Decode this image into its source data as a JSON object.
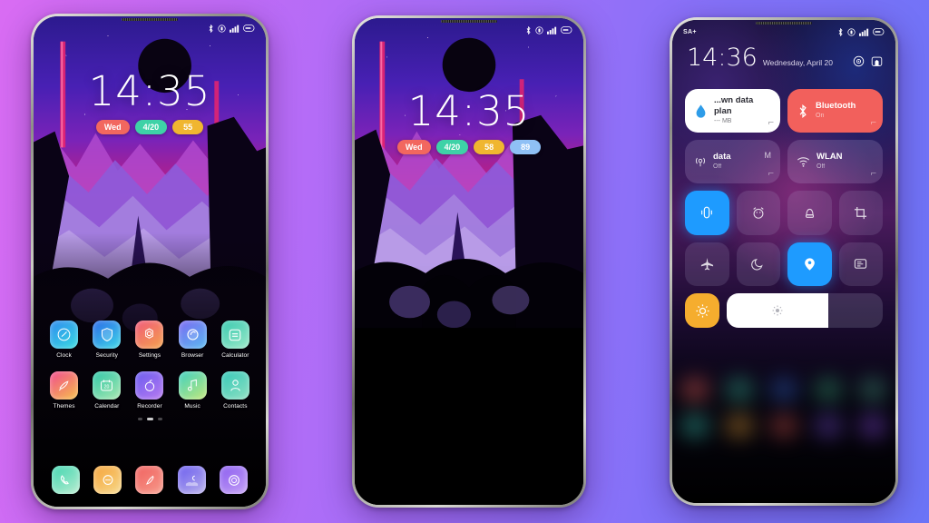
{
  "background": {
    "from": "#d96cf3",
    "to": "#6b74f7"
  },
  "phone1": {
    "name": "home-screen",
    "statusbar": {
      "left": "",
      "icons": [
        "bluetooth-icon",
        "vibrate-icon",
        "signal-icon",
        "battery-icon"
      ]
    },
    "clock": {
      "time": "14:35"
    },
    "badges": [
      {
        "label": "Wed",
        "color": "#f2675f"
      },
      {
        "label": "4/20",
        "color": "#3ed2a7"
      },
      {
        "label": "55",
        "color": "#f0b630"
      }
    ],
    "apps_row1": [
      {
        "label": "Clock",
        "icon": "clock-icon",
        "from": "#2e8bf0",
        "to": "#39dbe0"
      },
      {
        "label": "Security",
        "icon": "shield-icon",
        "from": "#2a6ae8",
        "to": "#3fd8e8"
      },
      {
        "label": "Settings",
        "icon": "gear-icon",
        "from": "#f0597a",
        "to": "#f4a34c"
      },
      {
        "label": "Browser",
        "icon": "globe-icon",
        "from": "#7b6af2",
        "to": "#59b9f0"
      },
      {
        "label": "Calculator",
        "icon": "calculator-icon",
        "from": "#39c9b0",
        "to": "#9ae8c8"
      }
    ],
    "apps_row2": [
      {
        "label": "Themes",
        "icon": "themes-icon",
        "from": "#f04a8e",
        "to": "#f7c04a"
      },
      {
        "label": "Calendar",
        "icon": "calendar-icon",
        "from": "#2fc7a8",
        "to": "#a8e8b0"
      },
      {
        "label": "Recorder",
        "icon": "recorder-icon",
        "from": "#6a5cf0",
        "to": "#b77af0"
      },
      {
        "label": "Music",
        "icon": "music-icon",
        "from": "#3fd0c0",
        "to": "#c2e87a"
      },
      {
        "label": "Contacts",
        "icon": "contacts-icon",
        "from": "#35c8b8",
        "to": "#8fe0c2"
      }
    ],
    "page_dots": {
      "count": 3,
      "active": 1
    },
    "dock": [
      {
        "name": "phone-app-icon",
        "icon": "phone-icon",
        "from": "#3fd6b0",
        "to": "#b8ecd0"
      },
      {
        "name": "messages-app-icon",
        "icon": "message-icon",
        "from": "#f5a33a",
        "to": "#f7d98a"
      },
      {
        "name": "notes-app-icon",
        "icon": "pen-icon",
        "from": "#f0605f",
        "to": "#f79a8a"
      },
      {
        "name": "gallery-app-icon",
        "icon": "moon-icon",
        "from": "#6a5cf0",
        "to": "#b8b0ea"
      },
      {
        "name": "camera-app-icon",
        "icon": "camera-icon",
        "from": "#8a5cf0",
        "to": "#c4a0f5"
      }
    ]
  },
  "phone2": {
    "name": "lock-screen",
    "statusbar": {
      "icons": [
        "bluetooth-icon",
        "vibrate-icon",
        "signal-icon",
        "battery-icon"
      ]
    },
    "clock": {
      "time": "14:35"
    },
    "badges": [
      {
        "label": "Wed",
        "color": "#f2675f"
      },
      {
        "label": "4/20",
        "color": "#3ed2a7"
      },
      {
        "label": "58",
        "color": "#f0b630"
      },
      {
        "label": "89",
        "color": "#8fc0f5"
      }
    ]
  },
  "phone3": {
    "name": "control-center",
    "statusbar": {
      "left": "SA+",
      "icons": [
        "bluetooth-icon",
        "vibrate-icon",
        "signal-icon",
        "battery-icon"
      ]
    },
    "time": "14:36",
    "date": "Wednesday, April 20",
    "head_icons": [
      "settings-target-icon",
      "edit-bookmark-icon"
    ],
    "big_tiles": [
      {
        "name": "mobile-data-plan-tile",
        "title": "...wn data plan",
        "sub": "--- MB",
        "icon": "water-drop-icon",
        "bg": "#ffffff",
        "fg": "#2b2b33",
        "icon_color": "#2e9ce8",
        "active": false
      },
      {
        "name": "bluetooth-tile",
        "title": "Bluetooth",
        "sub": "On",
        "icon": "bluetooth-icon",
        "bg": "#f2605c",
        "fg": "#ffffff",
        "icon_color": "#ffffff",
        "active": true
      }
    ],
    "data_tiles": [
      {
        "name": "mobile-data-tile",
        "title": "data",
        "sub": "Off",
        "right": "M",
        "icon": "cell-signal-icon"
      },
      {
        "name": "wlan-tile",
        "title": "WLAN",
        "sub": "Off",
        "right": "",
        "icon": "wifi-icon"
      }
    ],
    "toggles_row1": [
      {
        "name": "vibrate-toggle",
        "icon": "vibrate-icon",
        "active": true
      },
      {
        "name": "alarm-toggle",
        "icon": "alarm-icon",
        "active": false
      },
      {
        "name": "flashlight-toggle",
        "icon": "flashlight-icon",
        "active": false
      },
      {
        "name": "screenshot-toggle",
        "icon": "crop-icon",
        "active": false
      }
    ],
    "toggles_row2": [
      {
        "name": "airplane-mode-toggle",
        "icon": "airplane-icon",
        "active": false
      },
      {
        "name": "dnd-toggle",
        "icon": "moon-icon",
        "active": false
      },
      {
        "name": "location-toggle",
        "icon": "location-pin-icon",
        "active": true
      },
      {
        "name": "reading-mode-toggle",
        "icon": "reading-icon",
        "active": false
      }
    ],
    "brightness": {
      "auto_label": "auto-brightness",
      "auto_active": true,
      "percent": 65
    }
  }
}
